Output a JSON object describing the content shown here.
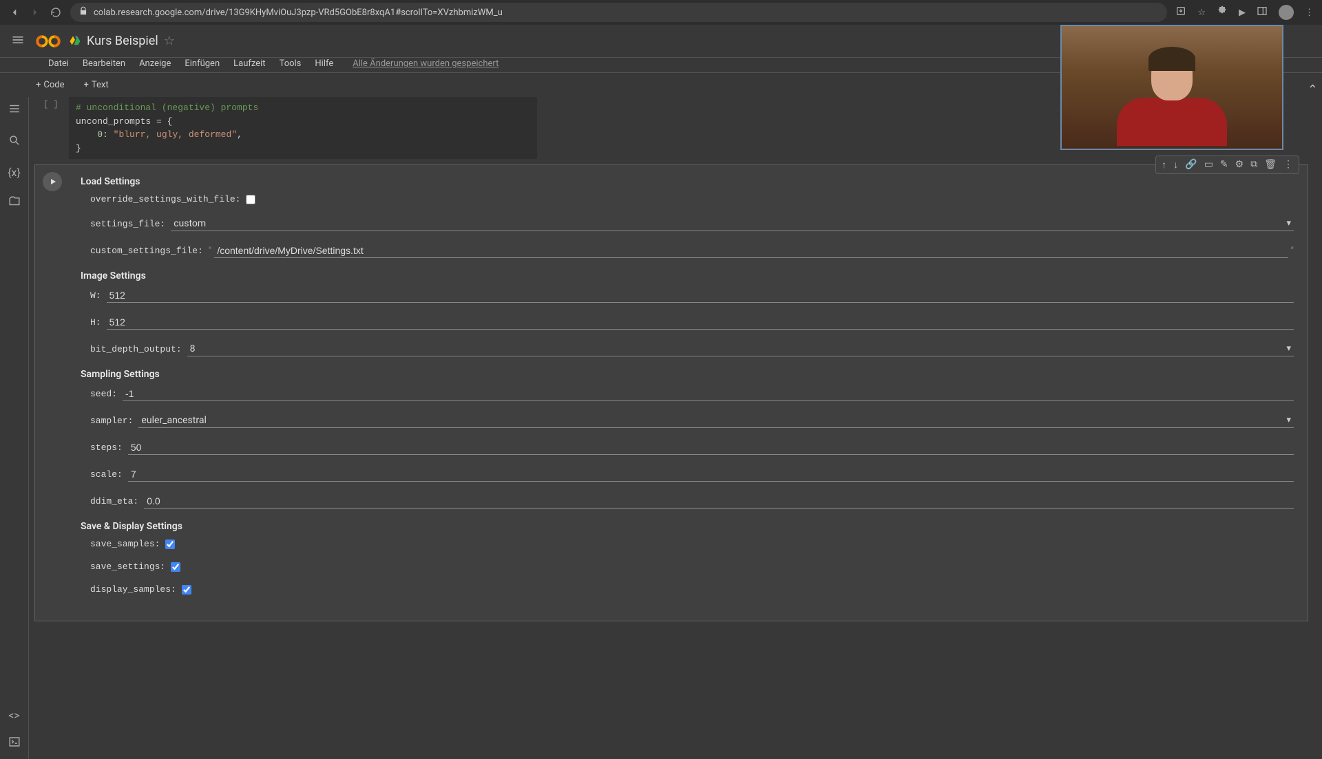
{
  "browser": {
    "url": "colab.research.google.com/drive/13G9KHyMviOuJ3pzp-VRd5GObE8r8xqA1#scrollTo=XVzhbmizWM_u"
  },
  "doc": {
    "title": "Kurs Beispiel"
  },
  "menu": {
    "datei": "Datei",
    "bearbeiten": "Bearbeiten",
    "anzeige": "Anzeige",
    "einfuegen": "Einfügen",
    "laufzeit": "Laufzeit",
    "tools": "Tools",
    "hilfe": "Hilfe",
    "save_status": "Alle Änderungen wurden gespeichert"
  },
  "toolbar": {
    "code": "Code",
    "text": "Text"
  },
  "code": {
    "comment": "# unconditional (negative) prompts",
    "line1": "uncond_prompts = {",
    "line2_key": "0",
    "line2_val": "\"blurr, ugly, deformed\"",
    "line3": "}",
    "gutter": "[ ]"
  },
  "form": {
    "sections": {
      "load": "Load Settings",
      "image": "Image Settings",
      "sampling": "Sampling Settings",
      "save": "Save & Display Settings"
    },
    "labels": {
      "override": "override_settings_with_file:",
      "settings_file": "settings_file:",
      "custom_settings_file": "custom_settings_file:",
      "W": "W:",
      "H": "H:",
      "bit_depth": "bit_depth_output:",
      "seed": "seed:",
      "sampler": "sampler:",
      "steps": "steps:",
      "scale": "scale:",
      "ddim_eta": "ddim_eta:",
      "save_samples": "save_samples:",
      "save_settings": "save_settings:",
      "display_samples": "display_samples:"
    },
    "values": {
      "settings_file": "custom",
      "custom_settings_file": "/content/drive/MyDrive/Settings.txt",
      "W": "512",
      "H": "512",
      "bit_depth": "8",
      "seed": "-1",
      "sampler": "euler_ancestral",
      "steps": "50",
      "scale": "7",
      "ddim_eta": "0.0"
    }
  }
}
